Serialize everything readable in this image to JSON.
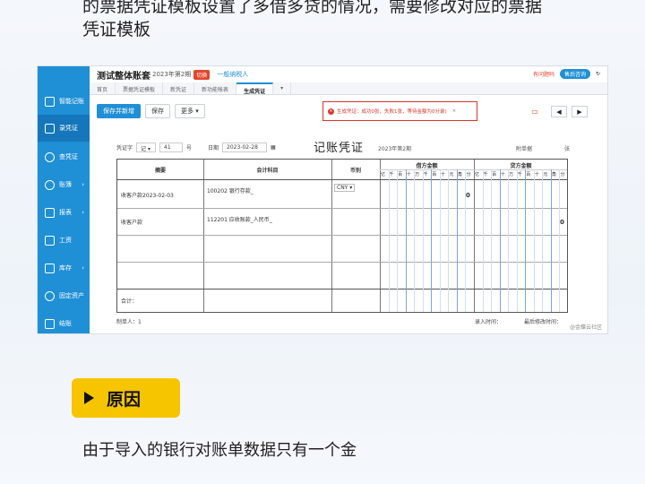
{
  "caption": {
    "line1": "的票据凭证模板设置了多借多贷的情况，需要修改对应的票据",
    "line2": "凭证模板"
  },
  "sidebar": {
    "items": [
      {
        "label": "智能记账",
        "icon": "monitor-icon"
      },
      {
        "label": "录凭证",
        "icon": "voucher-icon",
        "active": true
      },
      {
        "label": "查凭证",
        "icon": "search-icon"
      },
      {
        "label": "账簿",
        "icon": "yen-icon",
        "arrow": "›"
      },
      {
        "label": "报表",
        "icon": "report-icon",
        "arrow": "›"
      },
      {
        "label": "工资",
        "icon": "wage-icon"
      },
      {
        "label": "库存",
        "icon": "inventory-icon",
        "arrow": "›"
      },
      {
        "label": "固定资产",
        "icon": "asset-icon"
      },
      {
        "label": "结账",
        "icon": "checkout-icon"
      }
    ]
  },
  "header": {
    "title": "测试整体账套",
    "period": "2023年第2期",
    "switch": "切换",
    "taxpayer": "一般纳税人",
    "help": "有问题吗",
    "service": "售后咨询"
  },
  "tabs": [
    "首页",
    "票据凭证模板",
    "新凭证",
    "新功能帐表",
    "生成凭证"
  ],
  "toolbar": {
    "save_new": "保存并新增",
    "save": "保存",
    "more": "更多"
  },
  "error": {
    "text": "生成凭证：成功0张，失败1张，等待金额为0分录)",
    "close": "×"
  },
  "voucher": {
    "word_label": "凭证字",
    "word": "记",
    "no_label": "号",
    "date_label": "日期",
    "date": "2023-02-28",
    "title": "记账凭证",
    "period": "2023年第2期",
    "attach_label": "附单据",
    "attach_unit": "张"
  },
  "grid": {
    "headers": {
      "summary": "摘要",
      "account": "会计科目",
      "currency": "币别",
      "debit": "借方金额",
      "credit": "贷方金额"
    },
    "digits": [
      "亿",
      "千",
      "百",
      "十",
      "万",
      "千",
      "百",
      "十",
      "元",
      "角",
      "分"
    ],
    "rows": [
      {
        "summary": "收客户款2023-02-03",
        "account": "100202 银行存款_",
        "currency": "CNY",
        "debit": "0",
        "credit": ""
      },
      {
        "summary": "收客户款",
        "account": "112201 应收账款_人民币_",
        "currency": "",
        "debit": "",
        "credit": "0"
      }
    ],
    "total_label": "合计："
  },
  "footer": {
    "maker_label": "制单人：",
    "maker": "1",
    "post_label": "录入时间：",
    "modify_label": "最后修改时间："
  },
  "watermark": "@金蝶云社区",
  "badge": "原因",
  "reason": "由于导入的银行对账单数据只有一个金"
}
